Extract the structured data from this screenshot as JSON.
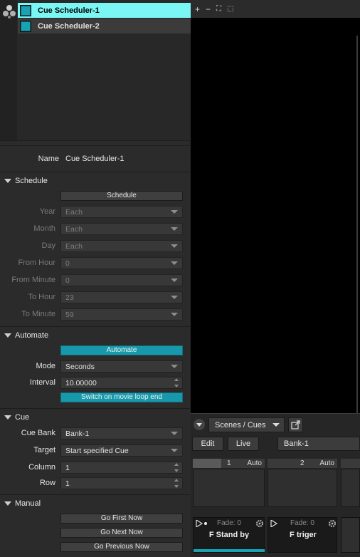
{
  "schedulers": {
    "items": [
      {
        "label": "Cue Scheduler-1",
        "selected": true
      },
      {
        "label": "Cue Scheduler-2",
        "selected": false
      }
    ]
  },
  "props": {
    "name_label": "Name",
    "name_value": "Cue Scheduler-1"
  },
  "schedule": {
    "title": "Schedule",
    "button": "Schedule",
    "rows": [
      {
        "label": "Year",
        "value": "Each"
      },
      {
        "label": "Month",
        "value": "Each"
      },
      {
        "label": "Day",
        "value": "Each"
      },
      {
        "label": "From Hour",
        "value": "0"
      },
      {
        "label": "From Minute",
        "value": "0"
      },
      {
        "label": "To Hour",
        "value": "23"
      },
      {
        "label": "To Minute",
        "value": "59"
      }
    ]
  },
  "automate": {
    "title": "Automate",
    "button": "Automate",
    "mode_label": "Mode",
    "mode_value": "Seconds",
    "interval_label": "Interval",
    "interval_value": "10.00000",
    "loop_button": "Switch on movie loop end"
  },
  "cue": {
    "title": "Cue",
    "bank_label": "Cue Bank",
    "bank_value": "Bank-1",
    "target_label": "Target",
    "target_value": "Start specified Cue",
    "column_label": "Column",
    "column_value": "1",
    "row_label": "Row",
    "row_value": "1"
  },
  "manual": {
    "title": "Manual",
    "first": "Go First Now",
    "next": "Go Next Now",
    "previous": "Go Previous Now"
  },
  "toolbar": {
    "add": "+",
    "remove": "−",
    "fullscreen": "⛶",
    "fit": "⬚"
  },
  "cues_panel": {
    "mode_select": "Scenes / Cues",
    "edit_tab": "Edit",
    "live_tab": "Live",
    "bank_select": "Bank-1",
    "columns": [
      {
        "number": "1",
        "mode": "Auto"
      },
      {
        "number": "2",
        "mode": "Auto"
      }
    ],
    "cards": [
      {
        "fade": "Fade: 0",
        "name": "F Stand by"
      },
      {
        "fade": "Fade: 0",
        "name": "F triger"
      }
    ]
  },
  "colors": {
    "accent": "#17a3b4",
    "selected_row": "#7af7f5",
    "teal_button": "#1799ab"
  }
}
